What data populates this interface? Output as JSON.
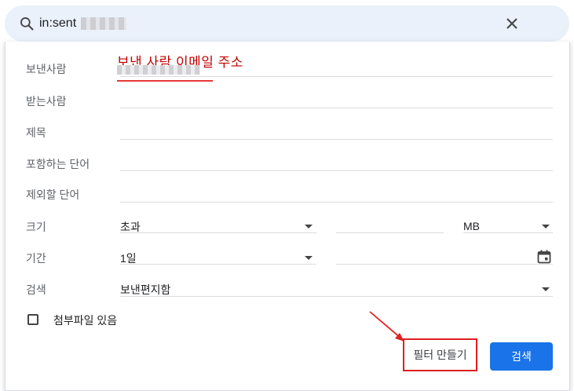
{
  "search": {
    "query": "in:sent",
    "icon": "search-icon",
    "close_icon": "close-icon"
  },
  "annotation": {
    "label": "보낸 사람 이메일 주소",
    "color": "#c00000"
  },
  "form": {
    "from_label": "보낸사람",
    "to_label": "받는사람",
    "subject_label": "제목",
    "has_words_label": "포함하는 단어",
    "not_words_label": "제외할 단어",
    "size_label": "크기",
    "size_operator": "초과",
    "size_unit": "MB",
    "date_label": "기간",
    "date_range": "1일",
    "search_label": "검색",
    "search_scope": "보낸편지함",
    "attachment_label": "첨부파일 있음"
  },
  "buttons": {
    "create_filter": "필터 만들기",
    "search": "검색"
  },
  "colors": {
    "accent": "#1a73e8",
    "search_bar_bg": "#eaf1fb",
    "highlight_red": "#e02020"
  }
}
